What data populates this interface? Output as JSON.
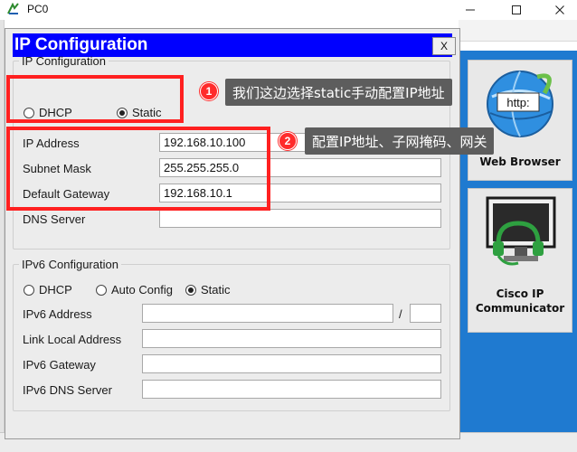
{
  "window": {
    "title": "PC0",
    "minimize_glyph": "—",
    "maximize_glyph": "☐",
    "close_glyph": "✕"
  },
  "dialog": {
    "title": "IP Configuration",
    "close_label": "X"
  },
  "ipv4": {
    "legend": "IP Configuration",
    "dhcp_label": "DHCP",
    "static_label": "Static",
    "selected_mode": "Static",
    "fields": {
      "ip_address_label": "IP Address",
      "ip_address_value": "192.168.10.100",
      "subnet_mask_label": "Subnet Mask",
      "subnet_mask_value": "255.255.255.0",
      "default_gateway_label": "Default Gateway",
      "default_gateway_value": "192.168.10.1",
      "dns_server_label": "DNS Server",
      "dns_server_value": ""
    }
  },
  "ipv6": {
    "legend": "IPv6 Configuration",
    "dhcp_label": "DHCP",
    "auto_config_label": "Auto Config",
    "static_label": "Static",
    "selected_mode": "Static",
    "fields": {
      "ipv6_address_label": "IPv6 Address",
      "ipv6_address_value": "",
      "prefix_separator": "/",
      "prefix_value": "",
      "link_local_label": "Link Local Address",
      "link_local_value": "",
      "ipv6_gateway_label": "IPv6 Gateway",
      "ipv6_gateway_value": "",
      "ipv6_dns_label": "IPv6 DNS Server",
      "ipv6_dns_value": ""
    }
  },
  "annotations": {
    "badge1": "1",
    "callout1": "我们这边选择static手动配置IP地址",
    "badge2": "2",
    "callout2": "配置IP地址、子网掩码、网关"
  },
  "desktop": {
    "web_browser_label": "Web Browser",
    "http_icon_text": "http:",
    "cisco_ip_label_line1": "Cisco IP",
    "cisco_ip_label_line2": "Communicator"
  },
  "colors": {
    "dialog_title_bg": "#0000ff",
    "annotation_red": "#ff2020",
    "callout_bg": "#5d5d5d",
    "desktop_blue": "#1f7ad0"
  }
}
